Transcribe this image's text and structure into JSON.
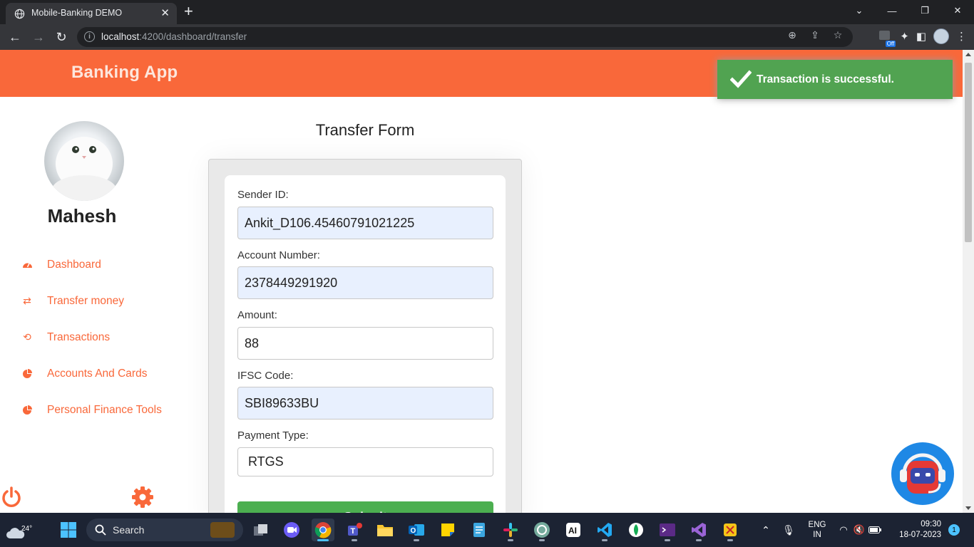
{
  "browser": {
    "tab_title": "Mobile-Banking DEMO",
    "url_host": "localhost",
    "url_path": ":4200/dashboard/transfer"
  },
  "app": {
    "brand": "Banking App",
    "colors": {
      "primary": "#f9683a",
      "success": "#51a351",
      "submit": "#4caf50"
    }
  },
  "toast": {
    "message": "Transaction is successful."
  },
  "sidebar": {
    "user_name": "Mahesh",
    "items": [
      {
        "label": "Dashboard",
        "icon": "dashboard-gauge-icon"
      },
      {
        "label": "Transfer money",
        "icon": "transfer-arrows-icon"
      },
      {
        "label": "Transactions",
        "icon": "history-icon"
      },
      {
        "label": "Accounts And Cards",
        "icon": "pie-chart-icon"
      },
      {
        "label": "Personal Finance Tools",
        "icon": "pie-chart-icon"
      }
    ]
  },
  "form": {
    "title": "Transfer Form",
    "fields": [
      {
        "label": "Sender ID:",
        "value": "Ankit_D106.45460791021225"
      },
      {
        "label": "Account Number:",
        "value": "2378449291920"
      },
      {
        "label": "Amount:",
        "value": "88"
      },
      {
        "label": "IFSC Code:",
        "value": "SBI89633BU"
      },
      {
        "label": "Payment Type:",
        "value": "RTGS"
      }
    ],
    "submit_label": "Submit"
  },
  "taskbar": {
    "weather_temp": "24°",
    "search_label": "Search",
    "language_top": "ENG",
    "language_bottom": "IN",
    "time": "09:30",
    "date": "18-07-2023",
    "notification_count": "1"
  }
}
